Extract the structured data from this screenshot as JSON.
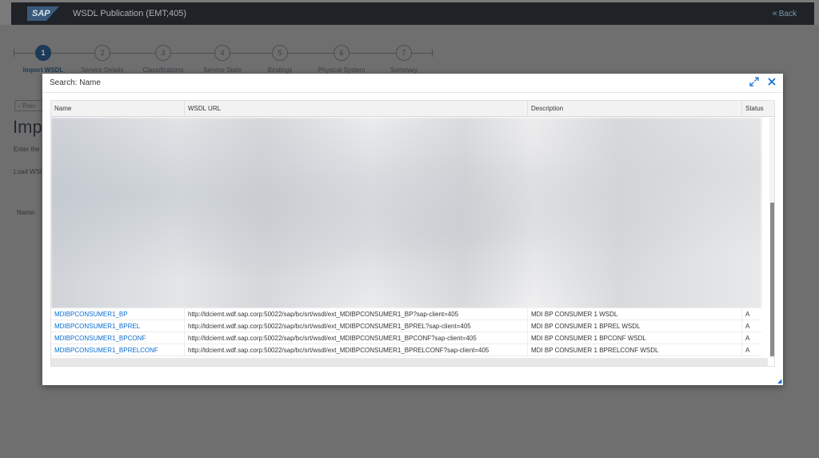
{
  "shell": {
    "logo_text": "SAP",
    "title": "WSDL Publication (EMT;405)",
    "back_label": "Back"
  },
  "wizard": {
    "steps": [
      {
        "num": "1",
        "label": "Import WSDL"
      },
      {
        "num": "2",
        "label": "Service Details"
      },
      {
        "num": "3",
        "label": "Classifications"
      },
      {
        "num": "4",
        "label": "Service State"
      },
      {
        "num": "5",
        "label": "Bindings"
      },
      {
        "num": "6",
        "label": "Physical System"
      },
      {
        "num": "7",
        "label": "Summary"
      }
    ],
    "active_step": 1
  },
  "background_page": {
    "prev_label": "Prev",
    "heading": "Imp",
    "text1": "Enter the",
    "text2": "Load WSI",
    "text3": "Name:"
  },
  "dialog": {
    "title": "Search: Name",
    "columns": [
      "Name",
      "WSDL URL",
      "Description",
      "Status"
    ],
    "rows": [
      {
        "name": "MDIBPCONSUMER1_BP",
        "url": "http://ldciemt.wdf.sap.corp:50022/sap/bc/srt/wsdl/ext_MDIBPCONSUMER1_BP?sap-client=405",
        "description": "MDI BP CONSUMER 1 WSDL",
        "status": "A"
      },
      {
        "name": "MDIBPCONSUMER1_BPREL",
        "url": "http://ldciemt.wdf.sap.corp:50022/sap/bc/srt/wsdl/ext_MDIBPCONSUMER1_BPREL?sap-client=405",
        "description": "MDI BP CONSUMER 1 BPREL WSDL",
        "status": "A"
      },
      {
        "name": "MDIBPCONSUMER1_BPCONF",
        "url": "http://ldciemt.wdf.sap.corp:50022/sap/bc/srt/wsdl/ext_MDIBPCONSUMER1_BPCONF?sap-client=405",
        "description": "MDI BP CONSUMER 1 BPCONF WSDL",
        "status": "A"
      },
      {
        "name": "MDIBPCONSUMER1_BPRELCONF",
        "url": "http://ldciemt.wdf.sap.corp:50022/sap/bc/srt/wsdl/ext_MDIBPCONSUMER1_BPRELCONF?sap-client=405",
        "description": "MDI BP CONSUMER 1 BPRELCONF WSDL",
        "status": "A"
      }
    ],
    "icons": {
      "expand": "expand-icon",
      "close": "close-icon"
    }
  },
  "colors": {
    "accent": "#0a6ed1",
    "shell": "#1f2226",
    "active_step": "#1d3a57"
  }
}
